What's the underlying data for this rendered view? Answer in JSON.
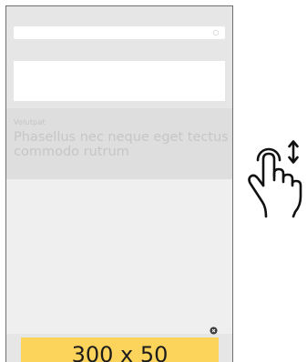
{
  "article": {
    "label": "Volutpat",
    "text": "Phasellus nec neque eget tectus commodo rutrum"
  },
  "ad": {
    "size_label": "300 x 50",
    "background": "#fcd35b"
  },
  "icons": {
    "search": "search-icon",
    "close": "close-icon",
    "gesture": "scroll-gesture-icon"
  }
}
